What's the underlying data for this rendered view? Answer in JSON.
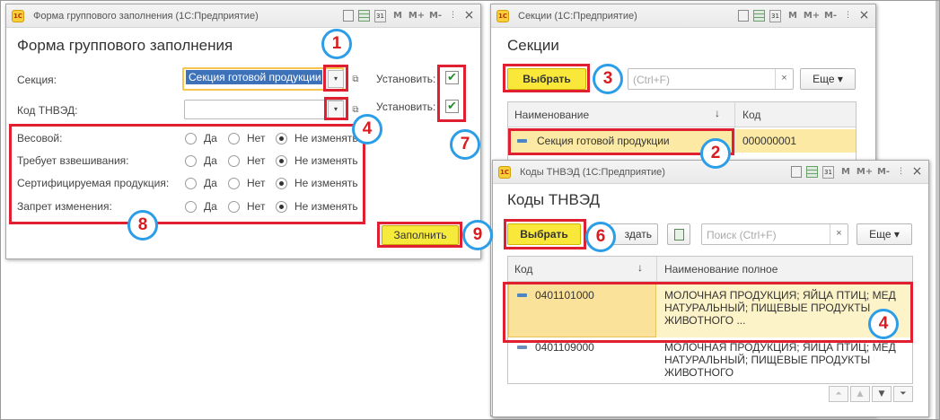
{
  "windows": {
    "group_fill": {
      "title": "Форма группового заполнения (1С:Предприятие)",
      "heading": "Форма группового заполнения",
      "section_label": "Секция:",
      "section_value": "Секция готовой продукции",
      "tnved_label": "Код ТНВЭД:",
      "tnved_value": "",
      "set_label_1": "Установить:",
      "set_label_2": "Установить:",
      "set_checked_1": "✔",
      "set_checked_2": "✔",
      "attributes": [
        {
          "label": "Весовой:",
          "options": [
            "Да",
            "Нет",
            "Не изменять"
          ],
          "selected": "Не изменять"
        },
        {
          "label": "Требует взвешивания:",
          "options": [
            "Да",
            "Нет",
            "Не изменять"
          ],
          "selected": "Не изменять"
        },
        {
          "label": "Сертифицируемая продукция:",
          "options": [
            "Да",
            "Нет",
            "Не изменять"
          ],
          "selected": "Не изменять"
        },
        {
          "label": "Запрет изменения:",
          "options": [
            "Да",
            "Нет",
            "Не изменять"
          ],
          "selected": "Не изменять"
        }
      ],
      "fill_button": "Заполнить"
    },
    "sections": {
      "title": "Секции (1С:Предприятие)",
      "heading": "Секции",
      "select_button": "Выбрать",
      "search_placeholder": "(Ctrl+F)",
      "search_clear": "×",
      "more_button": "Еще ▾",
      "columns": [
        "Наименование",
        "Код"
      ],
      "sort_arrow": "↓",
      "rows": [
        {
          "name": "Секция готовой продукции",
          "code": "000000001"
        }
      ]
    },
    "tnved": {
      "title": "Коды ТНВЭД (1С:Предприятие)",
      "heading": "Коды ТНВЭД",
      "select_button": "Выбрать",
      "create_button": "здать",
      "search_placeholder": "Поиск (Ctrl+F)",
      "search_clear": "×",
      "more_button": "Еще ▾",
      "columns": [
        "Код",
        "Наименование полное"
      ],
      "sort_arrow": "↓",
      "rows": [
        {
          "code": "0401101000",
          "name": "МОЛОЧНАЯ ПРОДУКЦИЯ; ЯЙЦА ПТИЦ; МЕД НАТУРАЛЬНЫЙ; ПИЩЕВЫЕ ПРОДУКТЫ ЖИВОТНОГО ..."
        },
        {
          "code": "0401109000",
          "name": "МОЛОЧНАЯ ПРОДУКЦИЯ; ЯЙЦА ПТИЦ; МЕД НАТУРАЛЬНЫЙ; ПИЩЕВЫЕ ПРОДУКТЫ ЖИВОТНОГО"
        }
      ]
    }
  },
  "toolbar_icons": {
    "m": "M",
    "m_plus": "M+",
    "m_minus": "M-",
    "calendar": "31",
    "menu": "⋮",
    "close": "×"
  },
  "callouts": {
    "c1": "1",
    "c2": "2",
    "c3": "3",
    "c4a": "4",
    "c4b": "4",
    "c4c": "4",
    "c6": "6",
    "c7": "7",
    "c8": "8",
    "c9": "9"
  },
  "colors": {
    "highlight_red": "#e02030",
    "callout_blue": "#2c9ee8",
    "selection_yellow": "#fbe9a4",
    "button_yellow": "#f9e83a"
  }
}
